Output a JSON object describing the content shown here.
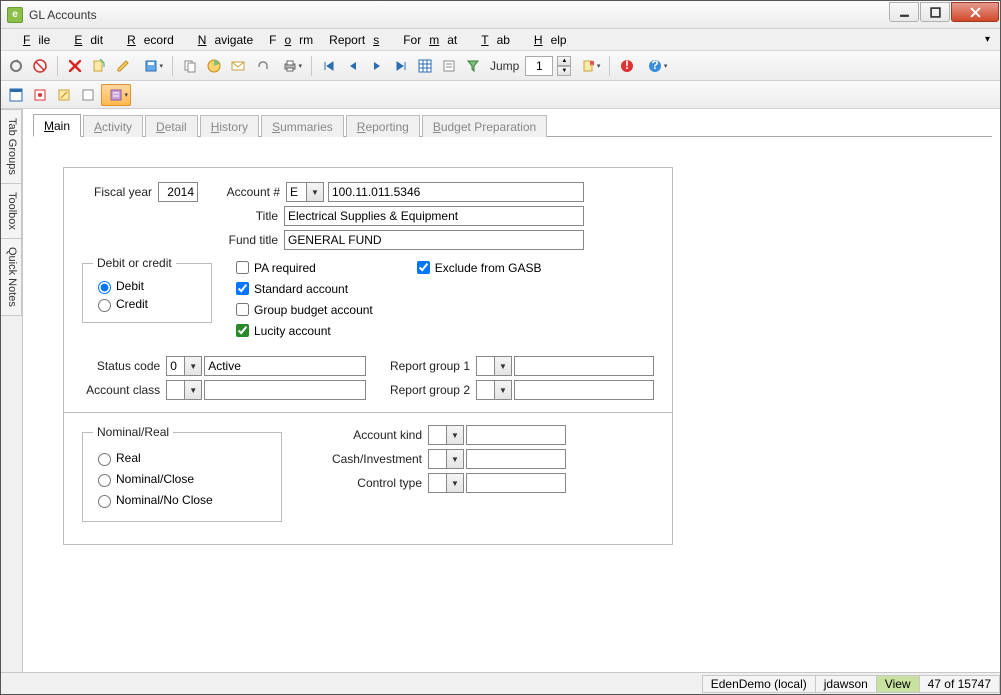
{
  "window": {
    "title": "GL Accounts"
  },
  "menu": [
    "File",
    "Edit",
    "Record",
    "Navigate",
    "Form",
    "Reports",
    "Format",
    "Tab",
    "Help"
  ],
  "jump": {
    "label": "Jump",
    "value": "1"
  },
  "sidetabs": [
    "Tab Groups",
    "Toolbox",
    "Quick Notes"
  ],
  "tabs": [
    "Main",
    "Activity",
    "Detail",
    "History",
    "Summaries",
    "Reporting",
    "Budget Preparation"
  ],
  "form": {
    "fiscal_year_label": "Fiscal year",
    "fiscal_year": "2014",
    "account_num_label": "Account #",
    "account_prefix": "E",
    "account_num": "100.11.011.5346",
    "title_label": "Title",
    "title": "Electrical Supplies & Equipment",
    "fund_title_label": "Fund title",
    "fund_title": "GENERAL FUND",
    "debit_credit_legend": "Debit or credit",
    "debit_label": "Debit",
    "credit_label": "Credit",
    "pa_required_label": "PA required",
    "standard_account_label": "Standard account",
    "group_budget_label": "Group budget account",
    "lucity_account_label": "Lucity account",
    "exclude_gasb_label": "Exclude from GASB",
    "status_code_label": "Status code",
    "status_code": "0",
    "status_text": "Active",
    "account_class_label": "Account class",
    "account_class": "",
    "report_group1_label": "Report group 1",
    "report_group1": "",
    "report_group2_label": "Report group 2",
    "report_group2": "",
    "nominal_real_legend": "Nominal/Real",
    "real_label": "Real",
    "nominal_close_label": "Nominal/Close",
    "nominal_noclose_label": "Nominal/No Close",
    "account_kind_label": "Account kind",
    "account_kind": "",
    "cash_inv_label": "Cash/Investment",
    "cash_inv": "",
    "control_type_label": "Control type",
    "control_type": ""
  },
  "status": {
    "server": "EdenDemo (local)",
    "user": "jdawson",
    "mode": "View",
    "record": "47 of 15747"
  }
}
